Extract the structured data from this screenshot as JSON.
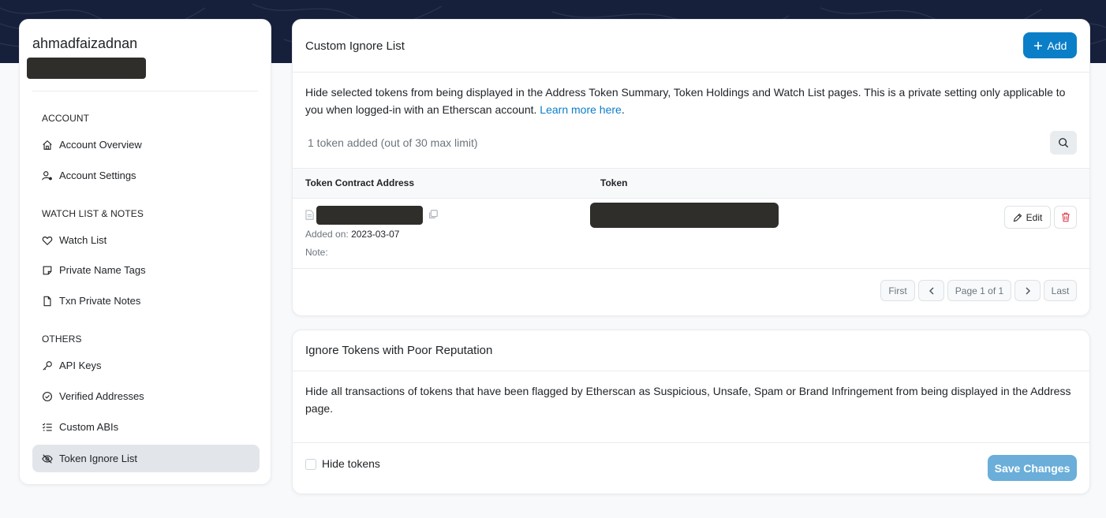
{
  "colors": {
    "brand_blue": "#0b7ec8",
    "top_band": "#17203b",
    "save_disabled": "#6aaed9",
    "delete_red": "#dc3545"
  },
  "sidebar": {
    "username": "ahmadfaizadnan",
    "sections": [
      {
        "title": "ACCOUNT",
        "items": [
          {
            "label": "Account Overview",
            "icon": "home-icon"
          },
          {
            "label": "Account Settings",
            "icon": "user-gear-icon"
          }
        ]
      },
      {
        "title": "WATCH LIST & NOTES",
        "items": [
          {
            "label": "Watch List",
            "icon": "heart-icon"
          },
          {
            "label": "Private Name Tags",
            "icon": "sticky-note-icon"
          },
          {
            "label": "Txn Private Notes",
            "icon": "file-icon"
          }
        ]
      },
      {
        "title": "OTHERS",
        "items": [
          {
            "label": "API Keys",
            "icon": "key-icon"
          },
          {
            "label": "Verified Addresses",
            "icon": "check-circle-icon"
          },
          {
            "label": "Custom ABIs",
            "icon": "list-check-icon"
          },
          {
            "label": "Token Ignore List",
            "icon": "eye-slash-icon",
            "active": true
          }
        ]
      }
    ]
  },
  "ignore_list": {
    "title": "Custom Ignore List",
    "add_label": "Add",
    "description": "Hide selected tokens from being displayed in the Address Token Summary, Token Holdings and Watch List pages. This is a private setting only applicable to you when logged-in with an Etherscan account. ",
    "learn_more": "Learn more here",
    "learn_more_suffix": ".",
    "count_text": "1 token added (out of 30 max limit)",
    "columns": {
      "address": "Token Contract Address",
      "token": "Token"
    },
    "row": {
      "added_on_label": "Added on:",
      "added_on_value": "2023-03-07",
      "note_label": "Note:",
      "edit_label": "Edit"
    },
    "pagination": {
      "first": "First",
      "page": "Page 1 of 1",
      "last": "Last"
    }
  },
  "poor_reputation": {
    "title": "Ignore Tokens with Poor Reputation",
    "description": "Hide all transactions of tokens that have been flagged by Etherscan as Suspicious, Unsafe, Spam or Brand Infringement from being displayed in the Address page.",
    "checkbox_label": "Hide tokens",
    "checkbox_checked": false,
    "save_label": "Save Changes"
  }
}
